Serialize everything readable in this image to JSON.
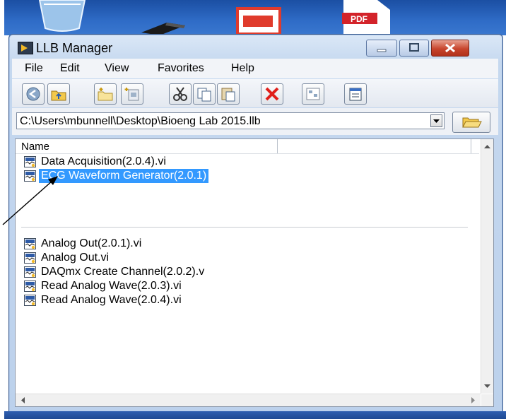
{
  "desktop": {
    "icons": [
      {
        "name": "recycle-bin-icon"
      },
      {
        "name": "shortcut-icon"
      },
      {
        "name": "app-shortcut-icon"
      },
      {
        "name": "pdf-icon",
        "label": "PDF"
      }
    ]
  },
  "window": {
    "title": "LLB Manager"
  },
  "menu": {
    "items": [
      "File",
      "Edit",
      "View",
      "Favorites",
      "Help"
    ]
  },
  "toolbar": {
    "buttons": [
      "back-icon",
      "up-folder-icon",
      "new-folder-icon",
      "new-item-icon",
      "cut-icon",
      "copy-icon",
      "paste-icon",
      "delete-icon",
      "properties-icon",
      "view-icon"
    ]
  },
  "path": {
    "value": "C:\\Users\\mbunnell\\Desktop\\Bioeng Lab 2015.llb"
  },
  "list": {
    "column_header": "Name",
    "group1": [
      {
        "label": "Data Acquisition(2.0.4).vi"
      },
      {
        "label": "ECG Waveform Generator(2.0.1)",
        "selected": true
      }
    ],
    "group2": [
      {
        "label": "Analog Out(2.0.1).vi"
      },
      {
        "label": "Analog Out.vi"
      },
      {
        "label": "DAQmx Create Channel(2.0.2).v"
      },
      {
        "label": "Read Analog Wave(2.0.3).vi"
      },
      {
        "label": "Read Analog Wave(2.0.4).vi"
      }
    ]
  },
  "colors": {
    "selection": "#3399ff",
    "titlebar": "#c5d8ef",
    "close_button": "#c7452d"
  }
}
